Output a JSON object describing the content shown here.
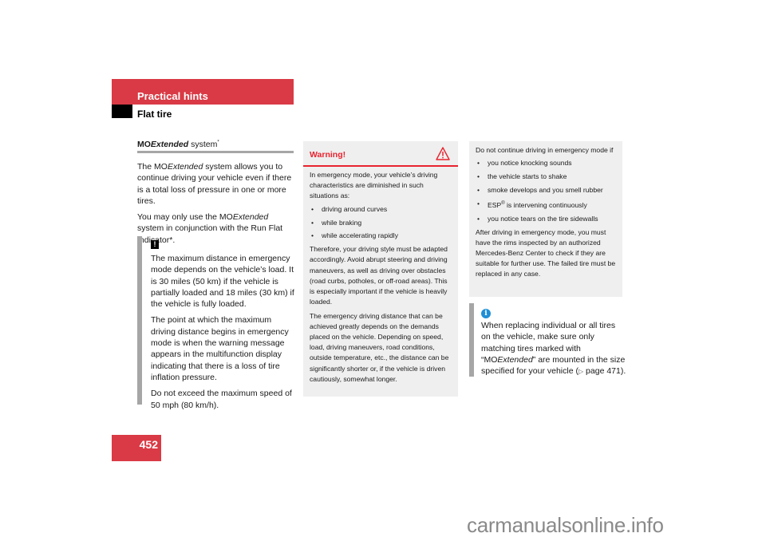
{
  "header": {
    "section": "Practical hints",
    "subsection": "Flat tire"
  },
  "page_number": "452",
  "colors": {
    "accent_red": "#d93a45",
    "warning_red": "#e8232f",
    "info_blue": "#1e8fd6",
    "box_gray": "#efefef",
    "bar_gray": "#a6a6a6"
  },
  "column1": {
    "heading_prefix": "MO",
    "heading_italic": "Extended",
    "heading_suffix": " system",
    "heading_mark": "*",
    "para1_prefix": "The MO",
    "para1_italic": "Extended",
    "para1_suffix": " system allows you to continue driving your vehicle even if there is a total loss of pressure in one or more tires.",
    "para2_prefix": "You may only use the MO",
    "para2_italic": "Extended",
    "para2_suffix": " system in conjunction with the Run Flat Indicator*.",
    "notice": {
      "icon": "exclamation-icon",
      "icon_glyph": "!",
      "paragraphs": [
        "The maximum distance in emergency mode depends on the vehicle’s load. It is 30 miles (50 km) if the vehicle is partially loaded and 18 miles (30 km) if the vehicle is fully loaded.",
        "The point at which the maximum driving distance begins in emergency mode is when the warning message appears in the multifunction display indicating that there is a loss of tire inflation pressure.",
        "Do not exceed the maximum speed of 50 mph (80 km/h)."
      ]
    }
  },
  "warning_box": {
    "title": "Warning!",
    "icon": "warning-triangle-icon",
    "intro": "In emergency mode, your vehicle’s driving characteristics are diminished in such situations as:",
    "bullets": [
      "driving around curves",
      "while braking",
      "while accelerating rapidly"
    ],
    "para1": "Therefore, your driving style must be adapted accordingly. Avoid abrupt steering and driving maneuvers, as well as driving over obstacles (road curbs, potholes, or off-road areas). This is especially important if the vehicle is heavily loaded.",
    "para2": "The emergency driving distance that can be achieved greatly depends on the demands placed on the vehicle. Depending on speed, load, driving maneuvers, road conditions, outside temperature, etc., the distance can be significantly shorter or, if the vehicle is driven cautiously, somewhat longer."
  },
  "right_box": {
    "intro": "Do not continue driving in emergency mode if",
    "bullets": [
      "you notice knocking sounds",
      "the vehicle starts to shake",
      "smoke develops and you smell rubber",
      "is intervening continuously",
      "you notice tears on the tire sidewalls"
    ],
    "esp_label": "ESP",
    "esp_mark": "®",
    "para": "After driving in emergency mode, you must have the rims inspected by an authorized Mercedes-Benz Center to check if they are suitable for further use. The failed tire must be replaced in any case."
  },
  "info_note": {
    "icon": "info-icon",
    "icon_glyph": "i",
    "text_prefix": "When replacing individual or all tires on the vehicle, make sure only matching tires marked with “MO",
    "text_italic": "Extended",
    "text_mid": "” are mounted in the size specified for your vehicle (",
    "page_ref_glyph": "▷",
    "text_suffix": " page 471)."
  },
  "watermark": "carmanualsonline.info"
}
